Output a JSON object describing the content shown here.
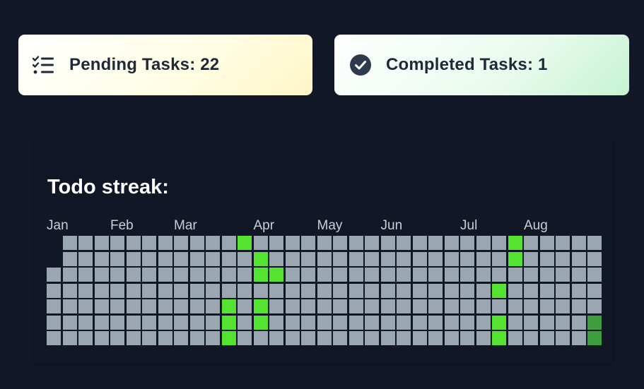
{
  "pending": {
    "icon": "checklist-icon",
    "label": "Pending Tasks: 22",
    "count": 22
  },
  "completed": {
    "icon": "check-circle-icon",
    "label": "Completed Tasks: 1",
    "count": 1
  },
  "streak": {
    "title": "Todo streak:",
    "months": [
      {
        "label": "Jan",
        "col": 0
      },
      {
        "label": "Feb",
        "col": 4
      },
      {
        "label": "Mar",
        "col": 8
      },
      {
        "label": "Apr",
        "col": 13
      },
      {
        "label": "May",
        "col": 17
      },
      {
        "label": "Jun",
        "col": 21
      },
      {
        "label": "Jul",
        "col": 26
      },
      {
        "label": "Aug",
        "col": 30
      }
    ],
    "weeks": 35,
    "days_per_week": 7,
    "first_week_start_row": 2,
    "colors": {
      "empty": "#9aa7b1",
      "active": "#55e332",
      "today": "#3e9d3e",
      "background": "#121828"
    },
    "active_cells": [
      {
        "week": 12,
        "day": 0,
        "level": 1
      },
      {
        "week": 13,
        "day": 1,
        "level": 1
      },
      {
        "week": 13,
        "day": 2,
        "level": 1
      },
      {
        "week": 14,
        "day": 2,
        "level": 1
      },
      {
        "week": 11,
        "day": 4,
        "level": 1
      },
      {
        "week": 11,
        "day": 5,
        "level": 1
      },
      {
        "week": 11,
        "day": 6,
        "level": 1
      },
      {
        "week": 13,
        "day": 4,
        "level": 1
      },
      {
        "week": 13,
        "day": 5,
        "level": 1
      },
      {
        "week": 28,
        "day": 3,
        "level": 1
      },
      {
        "week": 28,
        "day": 5,
        "level": 1
      },
      {
        "week": 28,
        "day": 6,
        "level": 1
      },
      {
        "week": 29,
        "day": 0,
        "level": 1
      },
      {
        "week": 29,
        "day": 1,
        "level": 1
      },
      {
        "week": 34,
        "day": 5,
        "level": 2
      },
      {
        "week": 34,
        "day": 6,
        "level": 2
      }
    ],
    "last_week_end_row": 6
  }
}
